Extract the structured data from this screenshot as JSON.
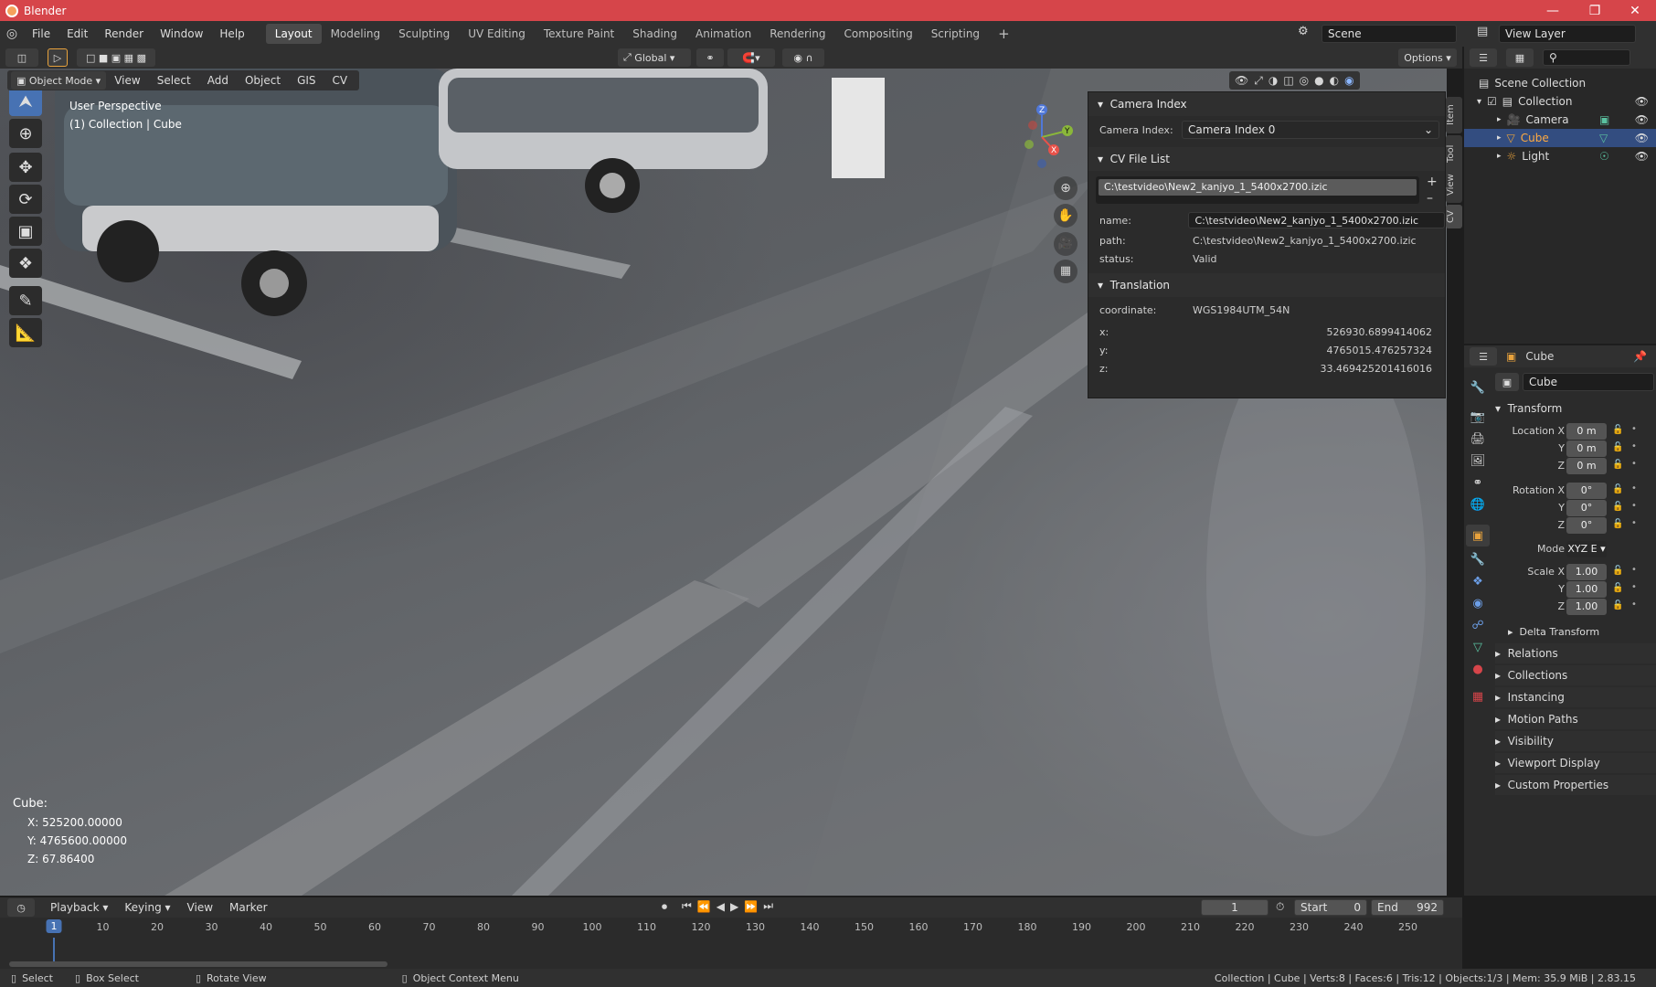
{
  "window": {
    "title": "Blender"
  },
  "menu": [
    "File",
    "Edit",
    "Render",
    "Window",
    "Help"
  ],
  "workspaces": [
    "Layout",
    "Modeling",
    "Sculpting",
    "UV Editing",
    "Texture Paint",
    "Shading",
    "Animation",
    "Rendering",
    "Compositing",
    "Scripting"
  ],
  "active_workspace": "Layout",
  "scene": {
    "name": "Scene",
    "view_layer": "View Layer"
  },
  "header": {
    "orientation": "Global",
    "options": "Options"
  },
  "viewport_menu": {
    "mode": "Object Mode",
    "items": [
      "View",
      "Select",
      "Add",
      "Object",
      "GIS",
      "CV"
    ]
  },
  "viewport": {
    "perspective": "User Perspective",
    "collection_label": "(1) Collection | Cube"
  },
  "overlay_info": {
    "title": "Cube:",
    "x": "X: 525200.00000",
    "y": "Y: 4765600.00000",
    "z": "Z: 67.86400"
  },
  "npanel": {
    "camera_section": "Camera Index",
    "camera_label": "Camera Index:",
    "camera_value": "Camera Index 0",
    "cv_section": "CV File List",
    "file_item": "C:\\testvideo\\New2_kanjyo_1_5400x2700.izic",
    "name_label": "name:",
    "name_value": "C:\\testvideo\\New2_kanjyo_1_5400x2700.izic",
    "path_label": "path:",
    "path_value": "C:\\testvideo\\New2_kanjyo_1_5400x2700.izic",
    "status_label": "status:",
    "status_value": "Valid",
    "translation_section": "Translation",
    "coord_label": "coordinate:",
    "coord_value": "WGS1984UTM_54N",
    "x_label": "x:",
    "x_value": "526930.6899414062",
    "y_label": "y:",
    "y_value": "4765015.476257324",
    "z_label": "z:",
    "z_value": "33.469425201416016"
  },
  "side_tabs": [
    "Item",
    "Tool",
    "View",
    "CV"
  ],
  "outliner": {
    "root": "Scene Collection",
    "collection": "Collection",
    "items": [
      "Camera",
      "Cube",
      "Light"
    ],
    "selected": "Cube"
  },
  "properties": {
    "object_name": "Cube",
    "object_field": "Cube",
    "transform": "Transform",
    "location_label": "Location X",
    "location": [
      "0 m",
      "0 m",
      "0 m"
    ],
    "rotation_label": "Rotation X",
    "rotation": [
      "0°",
      "0°",
      "0°"
    ],
    "mode_label": "Mode",
    "mode_value": "XYZ E",
    "scale_label": "Scale X",
    "scale": [
      "1.00",
      "1.00",
      "1.00"
    ],
    "axis_y": "Y",
    "axis_z": "Z",
    "delta": "Delta Transform",
    "panels": [
      "Relations",
      "Collections",
      "Instancing",
      "Motion Paths",
      "Visibility",
      "Viewport Display",
      "Custom Properties"
    ]
  },
  "timeline": {
    "menus": [
      "Playback",
      "Keying",
      "View",
      "Marker"
    ],
    "current_frame": "1",
    "start_label": "Start",
    "start": "0",
    "end_label": "End",
    "end": "992",
    "ticks": [
      "1",
      "10",
      "20",
      "30",
      "40",
      "50",
      "60",
      "70",
      "80",
      "90",
      "100",
      "110",
      "120",
      "130",
      "140",
      "150",
      "160",
      "170",
      "180",
      "190",
      "200",
      "210",
      "220",
      "230",
      "240",
      "250"
    ]
  },
  "statusbar": {
    "select": "Select",
    "box_select": "Box Select",
    "rotate": "Rotate View",
    "context": "Object Context Menu",
    "info": "Collection | Cube | Verts:8 | Faces:6 | Tris:12 | Objects:1/3 | Mem: 35.9 MiB | 2.83.15"
  },
  "colors": {
    "title_bar": "#d6454a",
    "accent": "#4772b3",
    "panel": "#2b2b2b",
    "selected_row": "#334d80"
  }
}
